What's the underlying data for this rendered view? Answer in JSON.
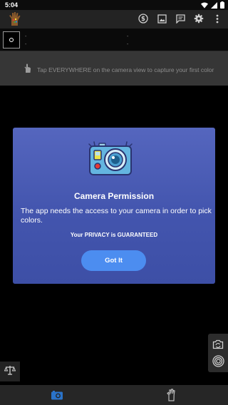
{
  "status_bar": {
    "time": "5:04",
    "icons": [
      "wifi-icon",
      "signal-icon",
      "battery-icon"
    ]
  },
  "app_bar": {
    "logo": "hand-palette-logo",
    "actions": [
      "dollar-icon",
      "image-icon",
      "chat-icon",
      "gear-icon",
      "more-vert-icon"
    ]
  },
  "color_bar": {
    "left_line1": "-",
    "left_line2": "-",
    "mid_line1": "-",
    "mid_line2": "-"
  },
  "hint": {
    "text": "Tap EVERYWHERE on the camera view to capture your first color"
  },
  "dialog": {
    "title": "Camera Permission",
    "body": "The app needs the access to your camera in order to pick colors.",
    "privacy": "Your PRIVACY is GUARANTEED",
    "button_label": "Got It"
  },
  "side_buttons": [
    "camera-switch-icon",
    "capture-target-icon"
  ],
  "balance_button": "balance-scale-icon",
  "bottom_nav": {
    "items": [
      "camera-tab-icon",
      "hand-tab-icon"
    ],
    "active": "camera-tab-icon",
    "active_color": "#2a73c9"
  },
  "colors": {
    "dialog_accent": "#4c8df0",
    "dialog_bg": "#4355ae"
  }
}
